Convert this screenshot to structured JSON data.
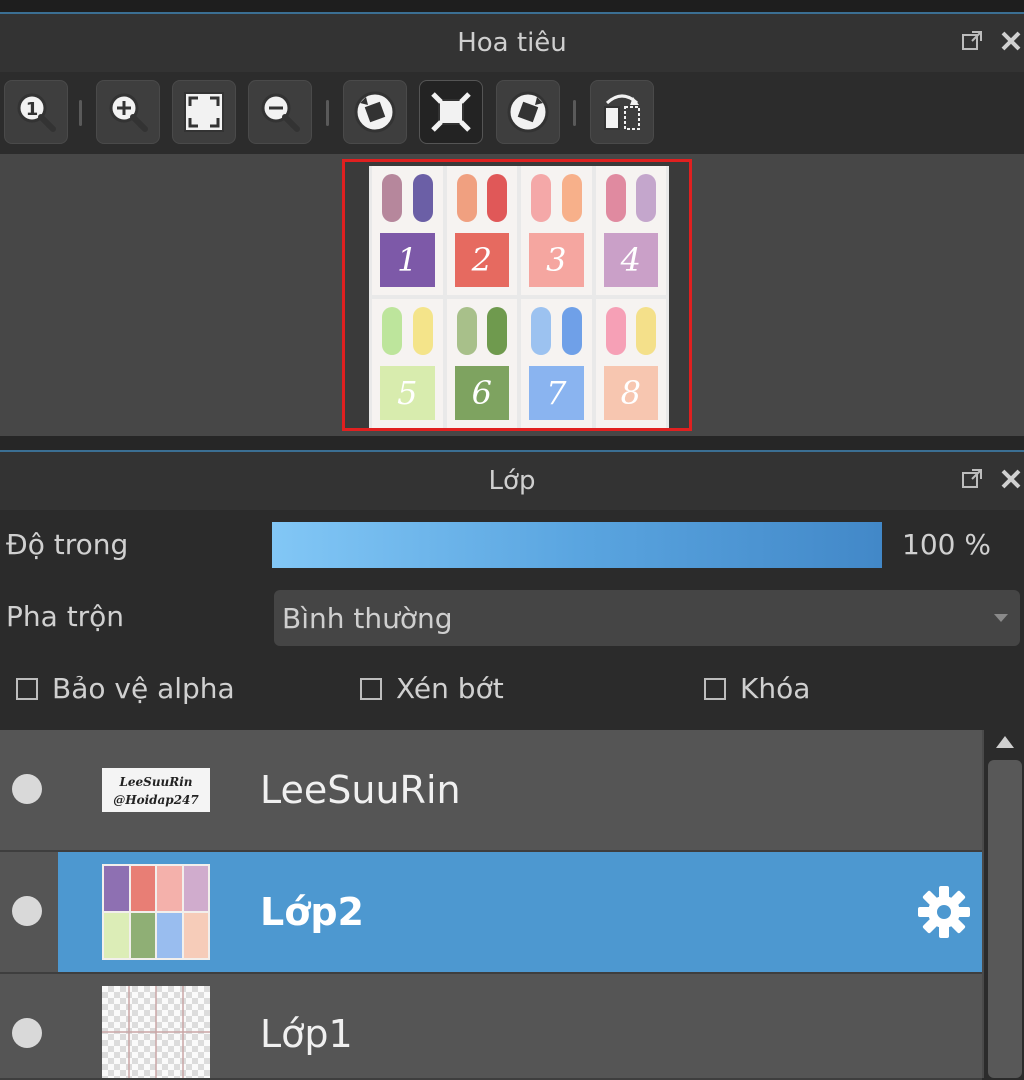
{
  "navigator": {
    "title": "Hoa tiêu",
    "toolbar": [
      {
        "name": "zoom-100-button",
        "icon": "zoom-1-icon"
      },
      {
        "name": "zoom-in-button",
        "icon": "zoom-in-icon"
      },
      {
        "name": "fit-screen-button",
        "icon": "fit-icon"
      },
      {
        "name": "zoom-out-button",
        "icon": "zoom-out-icon"
      },
      {
        "name": "rotate-left-button",
        "icon": "rotate-left-icon"
      },
      {
        "name": "actual-size-button",
        "icon": "frame-icon"
      },
      {
        "name": "rotate-right-button",
        "icon": "rotate-right-icon"
      },
      {
        "name": "flip-button",
        "icon": "flip-icon"
      }
    ],
    "preview_cards": [
      {
        "number": "1",
        "pill_a": "#b6879c",
        "pill_b": "#6b5fa6",
        "tile": "#7d59a8"
      },
      {
        "number": "2",
        "pill_a": "#f0a080",
        "pill_b": "#e05858",
        "tile": "#e66a60"
      },
      {
        "number": "3",
        "pill_a": "#f4a8a8",
        "pill_b": "#f7b08a",
        "tile": "#f5a6a0"
      },
      {
        "number": "4",
        "pill_a": "#e08aa0",
        "pill_b": "#c4a6cc",
        "tile": "#caa0c8"
      },
      {
        "number": "5",
        "pill_a": "#bde59c",
        "pill_b": "#f4e48a",
        "tile": "#d8ecae"
      },
      {
        "number": "6",
        "pill_a": "#a8c08a",
        "pill_b": "#6f9a4e",
        "tile": "#7ea360"
      },
      {
        "number": "7",
        "pill_a": "#9cc2f0",
        "pill_b": "#6fa0e8",
        "tile": "#8ab4f0"
      },
      {
        "number": "8",
        "pill_a": "#f6a0b6",
        "pill_b": "#f4e08a",
        "tile": "#f7c6b0"
      }
    ]
  },
  "layers": {
    "title": "Lớp",
    "opacity_label": "Độ trong",
    "opacity_value": "100 %",
    "opacity": 1.0,
    "blend_label": "Pha trộn",
    "blend_mode": "Bình thường",
    "checkboxes": {
      "protect_alpha": "Bảo vệ alpha",
      "clip": "Xén bớt",
      "lock": "Khóa"
    },
    "items": [
      {
        "name": "LeeSuuRin",
        "thumb_text_1": "LeeSuuRin",
        "thumb_text_2": "@Hoidap247"
      },
      {
        "name": "Lớp2",
        "selected": true
      },
      {
        "name": "Lớp1"
      }
    ]
  },
  "colors": {
    "selection": "#4d98d0",
    "opacity_bar": "#5aa5e0",
    "frame": "#e02020"
  }
}
